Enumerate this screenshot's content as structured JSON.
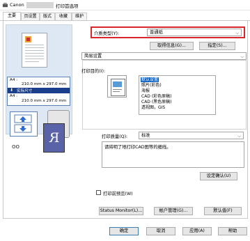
{
  "window": {
    "brand": "Canon",
    "title": "打印首选项"
  },
  "tabs": [
    {
      "label": "主要",
      "active": true
    },
    {
      "label": "页设置",
      "active": false
    },
    {
      "label": "版式",
      "active": false
    },
    {
      "label": "收藏",
      "active": false
    },
    {
      "label": "维护",
      "active": false
    }
  ],
  "preview": {
    "size_lines": [
      "A4 :",
      "210.0 mm x 297.0 mm",
      "实际尺寸",
      "A4 :",
      "210.0 mm x 297.0 mm"
    ],
    "paper_letter": "R"
  },
  "media": {
    "label": "介质类型(Y):",
    "value": "普通纸"
  },
  "buttons": {
    "get_info": "取得信息(G)...",
    "specify": "指定(S)...",
    "set_confirm": "设定确认(U)",
    "status_monitor": "Status Monitor(L)...",
    "account": "帐户管理(G)...",
    "defaults": "默认值(F)",
    "ok": "确定",
    "cancel": "取消",
    "apply": "应用(A)",
    "help": "帮助"
  },
  "mode": {
    "value": "简易设置"
  },
  "purpose": {
    "label": "打印目的(I):",
    "items": [
      {
        "label": "默认设置",
        "selected": true
      },
      {
        "label": "照片(彩色)",
        "selected": false
      },
      {
        "label": "海报",
        "selected": false
      },
      {
        "label": "CAD (彩色原稿)",
        "selected": false
      },
      {
        "label": "CAD (黑色原稿)",
        "selected": false
      },
      {
        "label": "透视图，GIS",
        "selected": false
      }
    ]
  },
  "quality": {
    "label": "打印质量(Q):",
    "value": "标准"
  },
  "comment": "请将明了地打印CAD图等的细线。",
  "preview_checkbox": {
    "label": "打印前预览(W)",
    "checked": false
  },
  "colors": {
    "accent_red": "#d9262b",
    "selection": "#0a64c8",
    "preview_bg": "#dde8f4",
    "paper_r": "#5b63a8"
  }
}
